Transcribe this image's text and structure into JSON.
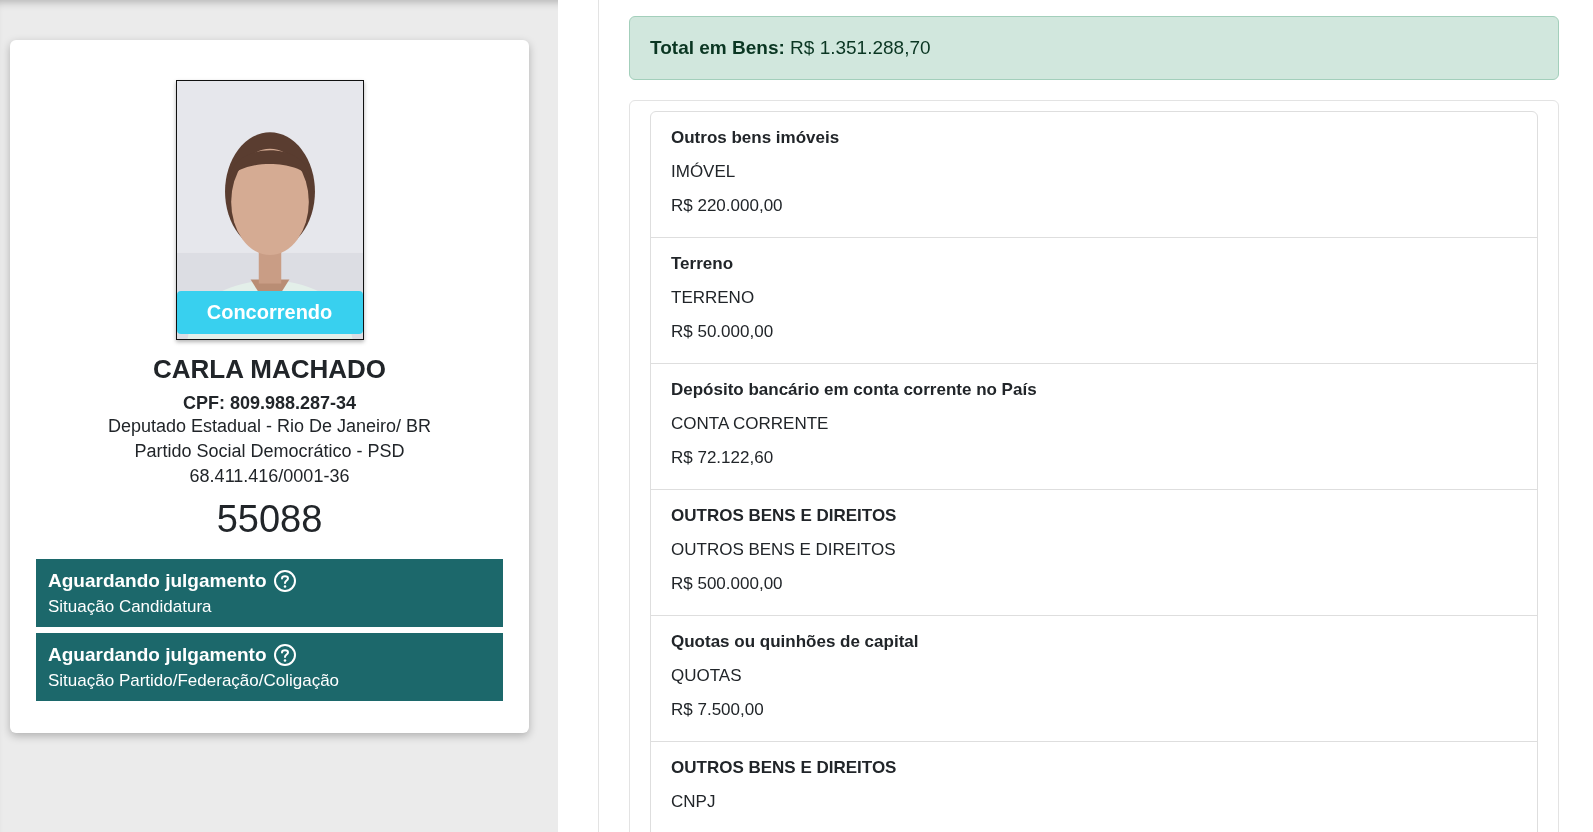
{
  "candidate": {
    "status_badge": "Concorrendo",
    "name": "CARLA MACHADO",
    "cpf": "CPF: 809.988.287-34",
    "office": "Deputado Estadual - Rio De Janeiro/ BR",
    "party": "Partido Social Democrático - PSD",
    "cnpj": "68.411.416/0001-36",
    "number": "55088"
  },
  "situations": [
    {
      "status": "Aguardando julgamento",
      "label": "Situação Candidatura"
    },
    {
      "status": "Aguardando julgamento",
      "label": "Situação Partido/Federação/Coligação"
    }
  ],
  "total": {
    "label": "Total em Bens:",
    "value": "R$ 1.351.288,70"
  },
  "assets": [
    {
      "title": "Outros bens imóveis",
      "type": "IMÓVEL",
      "value": "R$ 220.000,00"
    },
    {
      "title": "Terreno",
      "type": "TERRENO",
      "value": "R$ 50.000,00"
    },
    {
      "title": "Depósito bancário em conta corrente no País",
      "type": "CONTA CORRENTE",
      "value": "R$ 72.122,60"
    },
    {
      "title": "OUTROS BENS E DIREITOS",
      "type": "OUTROS BENS E DIREITOS",
      "value": "R$ 500.000,00"
    },
    {
      "title": "Quotas ou quinhões de capital",
      "type": "QUOTAS",
      "value": "R$ 7.500,00"
    },
    {
      "title": "OUTROS BENS E DIREITOS",
      "type": "CNPJ"
    }
  ]
}
